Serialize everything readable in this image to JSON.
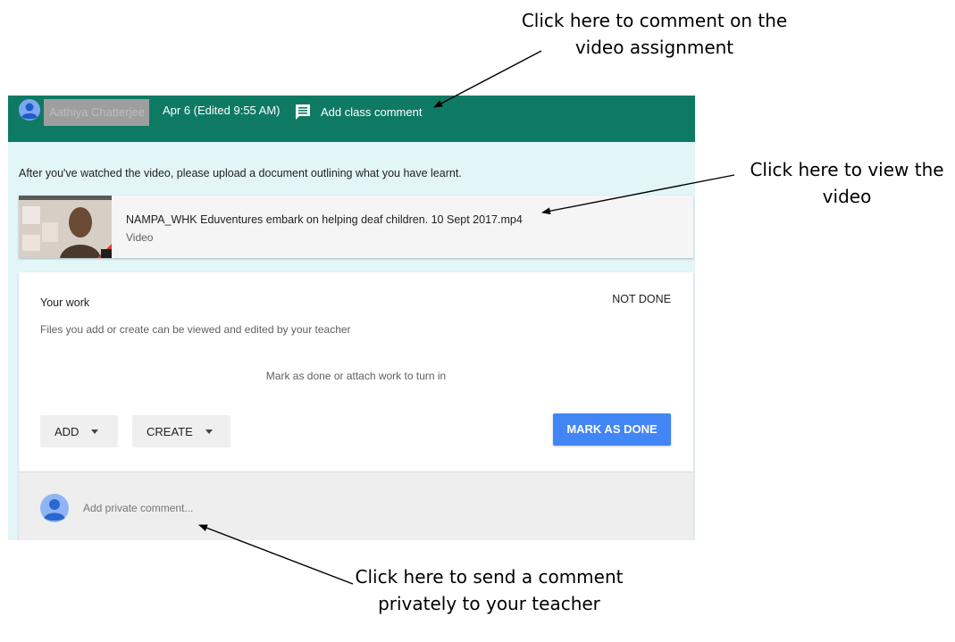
{
  "annotations": {
    "top": "Click here to comment on the video assignment",
    "right": "Click here to view the video",
    "bottom": "Click here to send a comment privately to your teacher"
  },
  "header": {
    "author_name": "Aathiya Chatterjee",
    "date": "Apr 6 (Edited 9:55 AM)",
    "comment_icon": "comment-icon",
    "add_class_comment": "Add class comment"
  },
  "instruction": "After you've watched the video, please upload a document outlining what you have learnt.",
  "video": {
    "title": "NAMPA_WHK Eduventures embark on helping deaf children. 10 Sept 2017.mp4",
    "type": "Video"
  },
  "your_work": {
    "title": "Your work",
    "status": "NOT DONE",
    "description": "Files you add or create can be viewed and edited by your teacher",
    "hint": "Mark as done or attach work to turn in",
    "add_label": "ADD",
    "create_label": "CREATE",
    "mark_done_label": "MARK AS DONE"
  },
  "private_comment": {
    "placeholder": "Add private comment..."
  },
  "colors": {
    "header_bg": "#0f7a63",
    "card_bg": "#e2f6f8",
    "accent_blue": "#4285f4"
  }
}
